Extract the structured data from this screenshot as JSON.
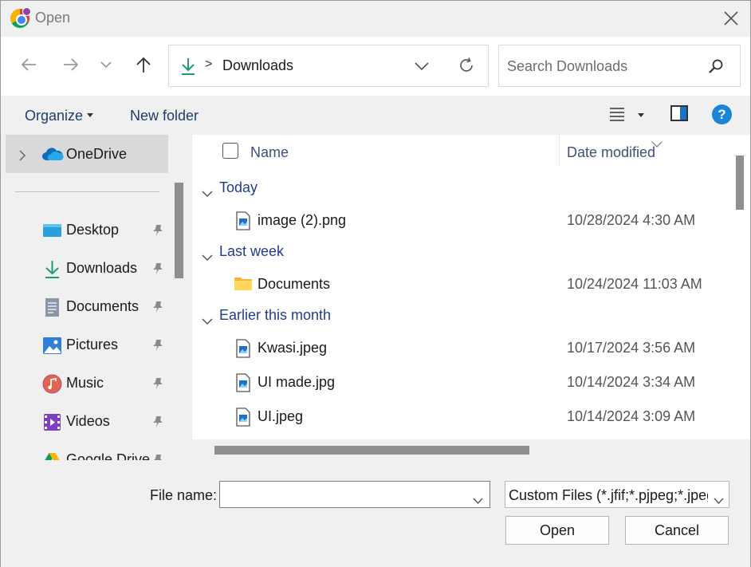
{
  "window": {
    "title": "Open",
    "app_icon": "chrome-profile-icon",
    "close_icon": "close-icon"
  },
  "nav": {
    "back_icon": "arrow-left-icon",
    "forward_icon": "arrow-right-icon",
    "recent_icon": "chevron-down-icon",
    "up_icon": "arrow-up-icon",
    "address": {
      "icon": "downloads-icon",
      "separator": ">",
      "location": "Downloads",
      "dropdown_icon": "chevron-down-icon",
      "refresh_icon": "refresh-icon"
    },
    "search": {
      "placeholder": "Search Downloads",
      "value": "",
      "icon": "search-icon"
    }
  },
  "toolbar": {
    "organize_label": "Organize",
    "new_folder_label": "New folder",
    "view_icon": "list-view-icon",
    "preview_pane_icon": "preview-pane-icon",
    "help_label": "?"
  },
  "sidebar": {
    "onedrive": {
      "label": "OneDrive",
      "icon": "onedrive-icon"
    },
    "items": [
      {
        "label": "Desktop",
        "icon": "desktop-icon",
        "pinned": true
      },
      {
        "label": "Downloads",
        "icon": "downloads-icon",
        "pinned": true
      },
      {
        "label": "Documents",
        "icon": "documents-icon",
        "pinned": true
      },
      {
        "label": "Pictures",
        "icon": "pictures-icon",
        "pinned": true
      },
      {
        "label": "Music",
        "icon": "music-icon",
        "pinned": true
      },
      {
        "label": "Videos",
        "icon": "videos-icon",
        "pinned": true
      },
      {
        "label": "Google Drive",
        "icon": "google-drive-icon",
        "pinned": true
      }
    ]
  },
  "filelist": {
    "columns": {
      "name": "Name",
      "date": "Date modified"
    },
    "groups": [
      {
        "label": "Today",
        "files": [
          {
            "name": "image (2).png",
            "date": "10/28/2024 4:30 AM",
            "icon": "image-file-icon"
          }
        ]
      },
      {
        "label": "Last week",
        "files": [
          {
            "name": "Documents",
            "date": "10/24/2024 11:03 AM",
            "icon": "folder-icon"
          }
        ]
      },
      {
        "label": "Earlier this month",
        "files": [
          {
            "name": "Kwasi.jpeg",
            "date": "10/17/2024 3:56 AM",
            "icon": "image-file-icon"
          },
          {
            "name": "UI made.jpg",
            "date": "10/14/2024 3:34 AM",
            "icon": "image-file-icon"
          },
          {
            "name": "UI.jpeg",
            "date": "10/14/2024 3:09 AM",
            "icon": "image-file-icon"
          }
        ]
      }
    ]
  },
  "footer": {
    "file_name_label": "File name:",
    "file_name_value": "",
    "file_type_value": "Custom Files (*.jfif;*.pjpeg;*.jpeg",
    "open_label": "Open",
    "cancel_label": "Cancel"
  },
  "colors": {
    "accent": "#1a84d6",
    "group_header": "#1f3c8c",
    "selection": "#d9d9d9",
    "downloads_green": "#1b9e6b"
  }
}
